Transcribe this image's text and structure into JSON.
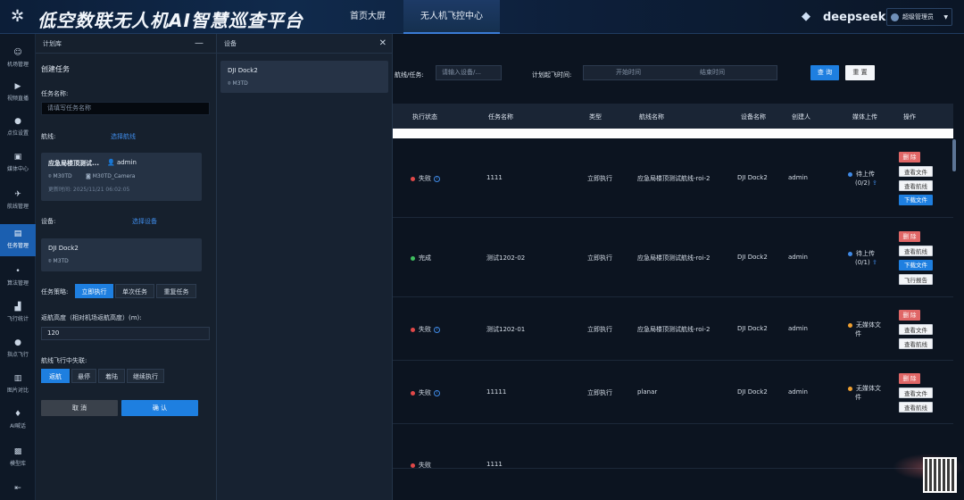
{
  "header": {
    "title": "低空数联无人机AI智慧巡查平台",
    "nav_home": "首页大屏",
    "nav_active": "无人机飞控中心",
    "brand": "deepseek",
    "user": "超级管理员"
  },
  "sidebar": {
    "items": [
      {
        "label": "机场管理",
        "icon": "person-icon"
      },
      {
        "label": "视频直播",
        "icon": "video-icon"
      },
      {
        "label": "点位设置",
        "icon": "pin-icon"
      },
      {
        "label": "媒体中心",
        "icon": "media-icon"
      },
      {
        "label": "航线管理",
        "icon": "route-icon"
      },
      {
        "label": "任务管理",
        "icon": "task-icon",
        "active": true
      },
      {
        "label": "算法管理",
        "icon": "algorithm-icon"
      },
      {
        "label": "飞行统计",
        "icon": "stats-icon"
      },
      {
        "label": "指点飞行",
        "icon": "point-icon"
      },
      {
        "label": "图片对比",
        "icon": "compare-icon"
      },
      {
        "label": "AI喊话",
        "icon": "mic-icon"
      },
      {
        "label": "模型库",
        "icon": "model-icon"
      }
    ],
    "collapse_icon": "collapse-icon"
  },
  "plan_panel": {
    "header": "计划库",
    "title": "创建任务",
    "task_name_label": "任务名称:",
    "task_name_placeholder": "请填写任务名称",
    "route_label": "航线:",
    "route_link": "选择航线",
    "route_card": {
      "name": "应急局楼顶测试...",
      "user": "admin",
      "device": "M30TD",
      "camera": "M30TD_Camera",
      "updated": "更新时间: 2025/11/21 06:02:05"
    },
    "device_label": "设备:",
    "device_link": "选择设备",
    "device_card": {
      "name": "DJI Dock2",
      "model": "M3TD"
    },
    "strategy_label": "任务策略:",
    "strategy_options": [
      "立即执行",
      "单次任务",
      "重复任务"
    ],
    "height_label": "返航高度（相对机场返航高度）(m):",
    "height_value": "120",
    "lost_label": "航线飞行中失联:",
    "lost_options": [
      "返航",
      "悬停",
      "着陆",
      "继续执行"
    ],
    "cancel": "取 消",
    "confirm": "确 认"
  },
  "device_panel": {
    "header": "设备",
    "item_name": "DJI Dock2",
    "item_model": "M3TD"
  },
  "filters": {
    "route_task_label": "航线/任务:",
    "route_task_placeholder": "请输入设备/...",
    "time_label": "计划起飞时间:",
    "start_placeholder": "开始时间",
    "end_placeholder": "结束时间",
    "query": "查 询",
    "reset": "重 置"
  },
  "table": {
    "headers": [
      "执行状态",
      "任务名称",
      "类型",
      "航线名称",
      "设备名称",
      "创建人",
      "媒体上传",
      "操作"
    ],
    "rows": [
      {
        "status": "失败",
        "status_color": "#e04848",
        "task": "1111",
        "type": "立即执行",
        "route": "应急局楼顶测试航线-roi-2",
        "device": "DJI Dock2",
        "creator": "admin",
        "upload": "待上传",
        "upload_sub": "(0/2)",
        "upload_color": "#3f8ae6",
        "actions": [
          "删 除",
          "查看文件",
          "查看航线",
          "下载文件"
        ]
      },
      {
        "status": "完成",
        "status_color": "#3fbf5f",
        "task": "测试1202-02",
        "type": "立即执行",
        "route": "应急局楼顶测试航线-roi-2",
        "device": "DJI Dock2",
        "creator": "admin",
        "upload": "待上传",
        "upload_sub": "(0/1)",
        "upload_color": "#3f8ae6",
        "actions": [
          "删 除",
          "查看航线",
          "下载文件",
          "飞行报告"
        ]
      },
      {
        "status": "失败",
        "status_color": "#e04848",
        "task": "测试1202-01",
        "type": "立即执行",
        "route": "应急局楼顶测试航线-roi-2",
        "device": "DJI Dock2",
        "creator": "admin",
        "upload": "无媒体文",
        "upload_sub": "件",
        "upload_color": "#f0a030",
        "actions": [
          "删 除",
          "查看文件",
          "查看航线"
        ]
      },
      {
        "status": "失败",
        "status_color": "#e04848",
        "task": "11111",
        "type": "立即执行",
        "route": "planar",
        "device": "DJI Dock2",
        "creator": "admin",
        "upload": "无媒体文",
        "upload_sub": "件",
        "upload_color": "#f0a030",
        "actions": [
          "删 除",
          "查看文件",
          "查看航线"
        ]
      },
      {
        "status": "失败",
        "status_color": "#e04848",
        "task": "1111",
        "type": "",
        "route": "",
        "device": "",
        "creator": "",
        "upload": "",
        "upload_sub": "",
        "upload_color": "#f0a030",
        "actions": []
      }
    ]
  }
}
